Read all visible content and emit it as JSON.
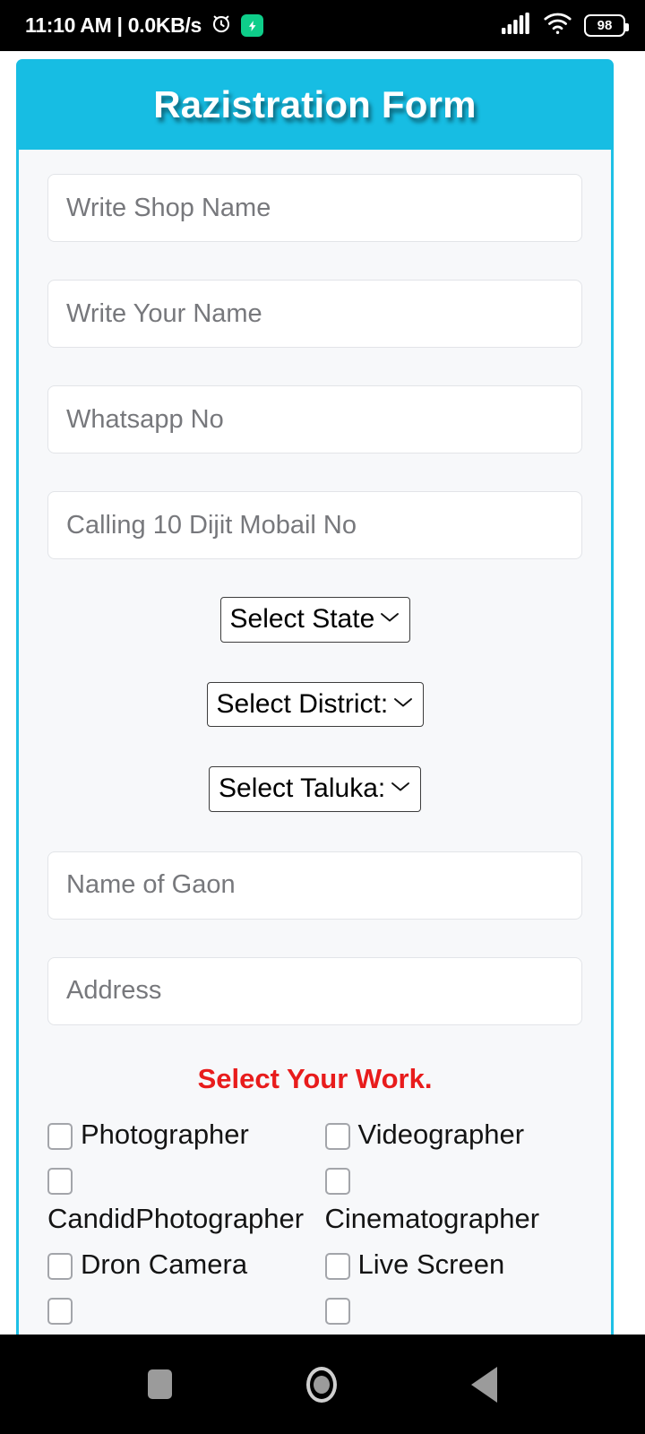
{
  "status_bar": {
    "clock": "11:10 AM | 0.0KB/s",
    "alarm_icon": "alarm-clock-icon",
    "badge_icon": "green-shield-bolt-icon",
    "signal_icon": "cellular-signal-icon",
    "wifi_icon": "wifi-icon",
    "battery_level": "98",
    "text_color": "#ffffff",
    "background": "#000000"
  },
  "form": {
    "title": "Razistration Form",
    "header_color": "#17bde3",
    "border_color": "#1ec0e6",
    "body_background": "#f7f8fa",
    "text_inputs": [
      {
        "name": "shop-name",
        "placeholder": "Write Shop Name",
        "value": ""
      },
      {
        "name": "your-name",
        "placeholder": "Write Your Name",
        "value": ""
      },
      {
        "name": "whatsapp-no",
        "placeholder": "Whatsapp No",
        "value": ""
      },
      {
        "name": "calling-no",
        "placeholder": "Calling 10 Dijit Mobail No",
        "value": ""
      }
    ],
    "selects": [
      {
        "name": "state",
        "selected": "Select State"
      },
      {
        "name": "district",
        "selected": "Select District:"
      },
      {
        "name": "taluka",
        "selected": "Select Taluka:"
      }
    ],
    "text_inputs_2": [
      {
        "name": "gaon-name",
        "placeholder": "Name of Gaon",
        "value": ""
      },
      {
        "name": "address",
        "placeholder": "Address",
        "value": ""
      }
    ],
    "work_heading": "Select Your Work.",
    "work_heading_color": "#e81c1c",
    "work_options": [
      {
        "label": "Photographer",
        "checked": false
      },
      {
        "label": "Videographer",
        "checked": false
      },
      {
        "label": "CandidPhotographer",
        "checked": false
      },
      {
        "label": "Cinematographer",
        "checked": false
      },
      {
        "label": "Dron Camera",
        "checked": false
      },
      {
        "label": "Live Screen",
        "checked": false
      }
    ]
  },
  "nav_bar": {
    "recents_icon": "square-recents-icon",
    "home_icon": "circle-home-icon",
    "back_icon": "triangle-back-icon"
  }
}
